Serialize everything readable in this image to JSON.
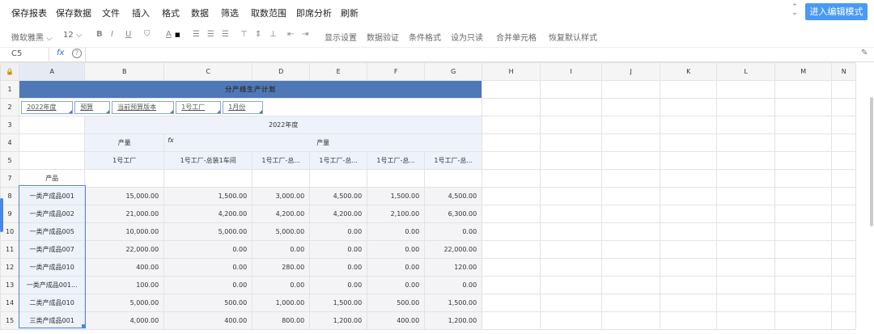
{
  "menu": {
    "items": [
      "保存报表",
      "保存数据",
      "文件",
      "插入",
      "格式",
      "数据",
      "筛选",
      "取数范围",
      "即席分析",
      "刷新"
    ],
    "edit_mode_button": "进入编辑模式"
  },
  "toolbar": {
    "font_name": "微软雅黑",
    "font_size": "12",
    "bold": "B",
    "italic": "I",
    "underline": "U",
    "font_color": "A",
    "actions": [
      "显示设置",
      "数据验证",
      "条件格式",
      "设为只读",
      "合并单元格",
      "恢复默认样式"
    ]
  },
  "formula_bar": {
    "cell_ref": "C5",
    "fx_label": "fx",
    "help": "?"
  },
  "sheet": {
    "columns": [
      "A",
      "B",
      "C",
      "D",
      "E",
      "F",
      "G",
      "H",
      "I",
      "J",
      "K",
      "L",
      "M",
      "N"
    ],
    "title": "分产线生产计划",
    "filters": [
      "2022年度",
      "预算",
      "当前预算版本",
      "1号工厂",
      "1月份"
    ],
    "year_header": "2022年度",
    "output_label_b": "产量",
    "output_label_group": "产量",
    "fx_mark": "fx",
    "factory_headers": [
      "1号工厂",
      "1号工厂-总装1车间",
      "1号工厂-总...",
      "1号工厂-总...",
      "1号工厂-总...",
      "1号工厂-总..."
    ],
    "product_label": "产品",
    "row_numbers": [
      "1",
      "2",
      "3",
      "4",
      "5",
      "7",
      "8",
      "9",
      "10",
      "11",
      "12",
      "13",
      "14",
      "15"
    ],
    "rows": [
      {
        "product": "一类产成品001",
        "values": [
          "15,000.00",
          "1,500.00",
          "3,000.00",
          "4,500.00",
          "1,500.00",
          "4,500.00"
        ]
      },
      {
        "product": "一类产成品002",
        "values": [
          "21,000.00",
          "4,200.00",
          "4,200.00",
          "4,200.00",
          "2,100.00",
          "6,300.00"
        ]
      },
      {
        "product": "一类产成品005",
        "values": [
          "10,000.00",
          "5,000.00",
          "5,000.00",
          "0.00",
          "0.00",
          "0.00"
        ]
      },
      {
        "product": "一类产成品007",
        "values": [
          "22,000.00",
          "0.00",
          "0.00",
          "0.00",
          "0.00",
          "22,000.00"
        ]
      },
      {
        "product": "一类产成品010",
        "values": [
          "400.00",
          "0.00",
          "280.00",
          "0.00",
          "0.00",
          "120.00"
        ]
      },
      {
        "product": "一类产成品001...",
        "values": [
          "100.00",
          "0.00",
          "0.00",
          "0.00",
          "0.00",
          "0.00"
        ]
      },
      {
        "product": "二类产成品010",
        "values": [
          "5,000.00",
          "500.00",
          "1,000.00",
          "1,500.00",
          "500.00",
          "1,500.00"
        ]
      },
      {
        "product": "三类产成品001",
        "values": [
          "4,000.00",
          "400.00",
          "800.00",
          "1,200.00",
          "400.00",
          "1,200.00"
        ]
      }
    ]
  }
}
